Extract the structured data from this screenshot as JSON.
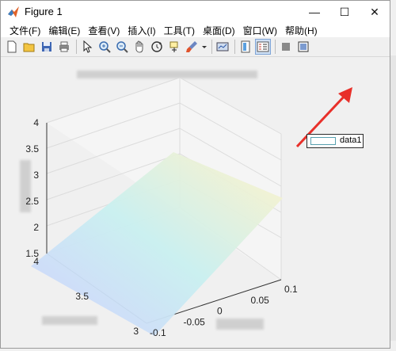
{
  "window": {
    "title": "Figure 1",
    "controls": {
      "minimize": "—",
      "maximize": "☐",
      "close": "✕"
    }
  },
  "menu": [
    "文件(F)",
    "编辑(E)",
    "查看(V)",
    "插入(I)",
    "工具(T)",
    "桌面(D)",
    "窗口(W)",
    "帮助(H)"
  ],
  "toolbar": [
    "new-figure-icon",
    "open-file-icon",
    "save-icon",
    "print-icon",
    "select-arrow-icon",
    "zoom-in-icon",
    "zoom-out-icon",
    "pan-hand-icon",
    "rotate-3d-icon",
    "data-cursor-icon",
    "brush-icon",
    "link-plot-icon",
    "colorbar-icon",
    "legend-icon",
    "hide-plot-tools-icon",
    "show-plot-tools-icon"
  ],
  "legend": {
    "label": "data1"
  },
  "chart_data": {
    "type": "surface",
    "title": "",
    "xlabel": "",
    "ylabel": "",
    "zlabel": "",
    "x_ticks": [
      "-0.1",
      "-0.05",
      "0",
      "0.05",
      "0.1"
    ],
    "y_ticks": [
      "3",
      "3.5",
      "4"
    ],
    "z_ticks": [
      "1.5",
      "2",
      "2.5",
      "3",
      "3.5",
      "4"
    ],
    "xlim": [
      -0.1,
      0.1
    ],
    "ylim": [
      3,
      4
    ],
    "zlim": [
      1.5,
      4
    ],
    "legend": [
      "data1"
    ],
    "legend_position": "top-right",
    "grid": true
  },
  "annotation": {
    "color": "#e8302a"
  },
  "colors": {
    "surface_low": "#cfcfff",
    "surface_mid": "#c9f0f0",
    "surface_high": "#fff2c8"
  }
}
